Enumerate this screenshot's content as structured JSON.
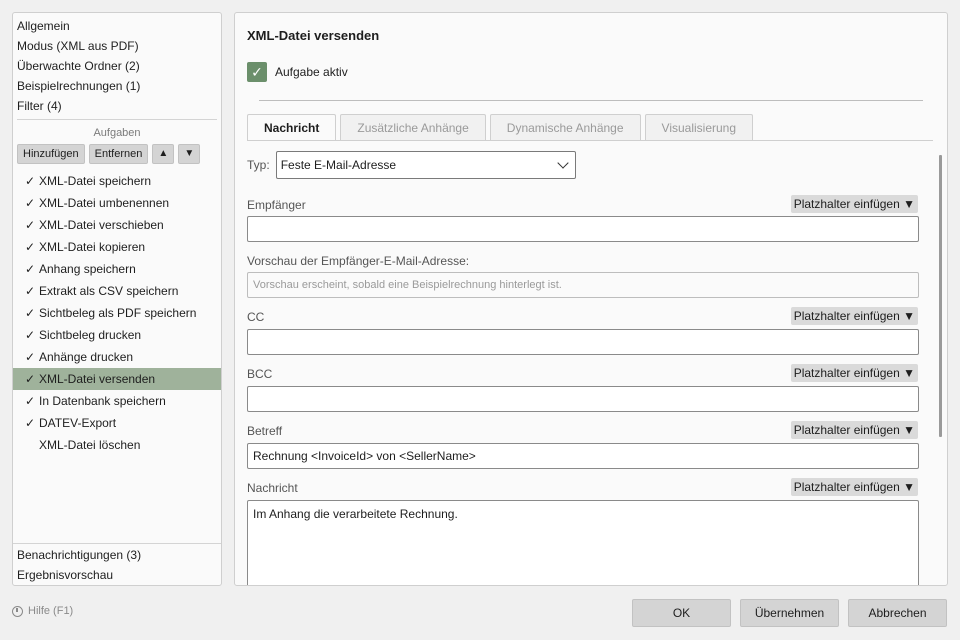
{
  "sidebar": {
    "top_items": [
      {
        "label": "Allgemein"
      },
      {
        "label": "Modus (XML aus PDF)"
      },
      {
        "label": "Überwachte Ordner (2)"
      },
      {
        "label": "Beispielrechnungen (1)"
      },
      {
        "label": "Filter (4)"
      }
    ],
    "tasks_title": "Aufgaben",
    "add_label": "Hinzufügen",
    "remove_label": "Entfernen",
    "up_glyph": "▲",
    "down_glyph": "▼",
    "tasks": [
      {
        "label": "XML-Datei speichern",
        "check": "✓"
      },
      {
        "label": "XML-Datei umbenennen",
        "check": "✓"
      },
      {
        "label": "XML-Datei verschieben",
        "check": "✓"
      },
      {
        "label": "XML-Datei kopieren",
        "check": "✓"
      },
      {
        "label": "Anhang speichern",
        "check": "✓"
      },
      {
        "label": "Extrakt als CSV speichern",
        "check": "✓"
      },
      {
        "label": "Sichtbeleg als PDF speichern",
        "check": "✓"
      },
      {
        "label": "Sichtbeleg drucken",
        "check": "✓"
      },
      {
        "label": "Anhänge drucken",
        "check": "✓"
      },
      {
        "label": "XML-Datei versenden",
        "check": "✓",
        "selected": true
      },
      {
        "label": "In Datenbank speichern",
        "check": "✓"
      },
      {
        "label": "DATEV-Export",
        "check": "✓"
      },
      {
        "label": "XML-Datei löschen",
        "check": ""
      }
    ],
    "bottom_items": [
      {
        "label": "Benachrichtigungen (3)"
      },
      {
        "label": "Ergebnisvorschau"
      }
    ]
  },
  "main": {
    "title": "XML-Datei versenden",
    "active_label": "Aufgabe aktiv",
    "active_check": "✓",
    "tabs": [
      {
        "label": "Nachricht",
        "active": true
      },
      {
        "label": "Zusätzliche Anhänge"
      },
      {
        "label": "Dynamische Anhänge"
      },
      {
        "label": "Visualisierung"
      }
    ],
    "type_label": "Typ:",
    "type_value": "Feste E-Mail-Adresse",
    "placeholder_btn": "Platzhalter einfügen ▼",
    "recipient_label": "Empfänger",
    "recipient_value": "",
    "preview_label": "Vorschau der Empfänger-E-Mail-Adresse:",
    "preview_value": "Vorschau erscheint, sobald eine Beispielrechnung hinterlegt ist.",
    "cc_label": "CC",
    "cc_value": "",
    "bcc_label": "BCC",
    "bcc_value": "",
    "subject_label": "Betreff",
    "subject_value": "Rechnung <InvoiceId> von <SellerName>",
    "message_label": "Nachricht",
    "message_value": "Im Anhang die verarbeitete Rechnung."
  },
  "footer": {
    "help_label": "Hilfe (F1)",
    "ok_label": "OK",
    "apply_label": "Übernehmen",
    "cancel_label": "Abbrechen"
  },
  "colors": {
    "selected_task_bg": "#9fb29b",
    "checkbox_bg": "#6b8f6b"
  }
}
